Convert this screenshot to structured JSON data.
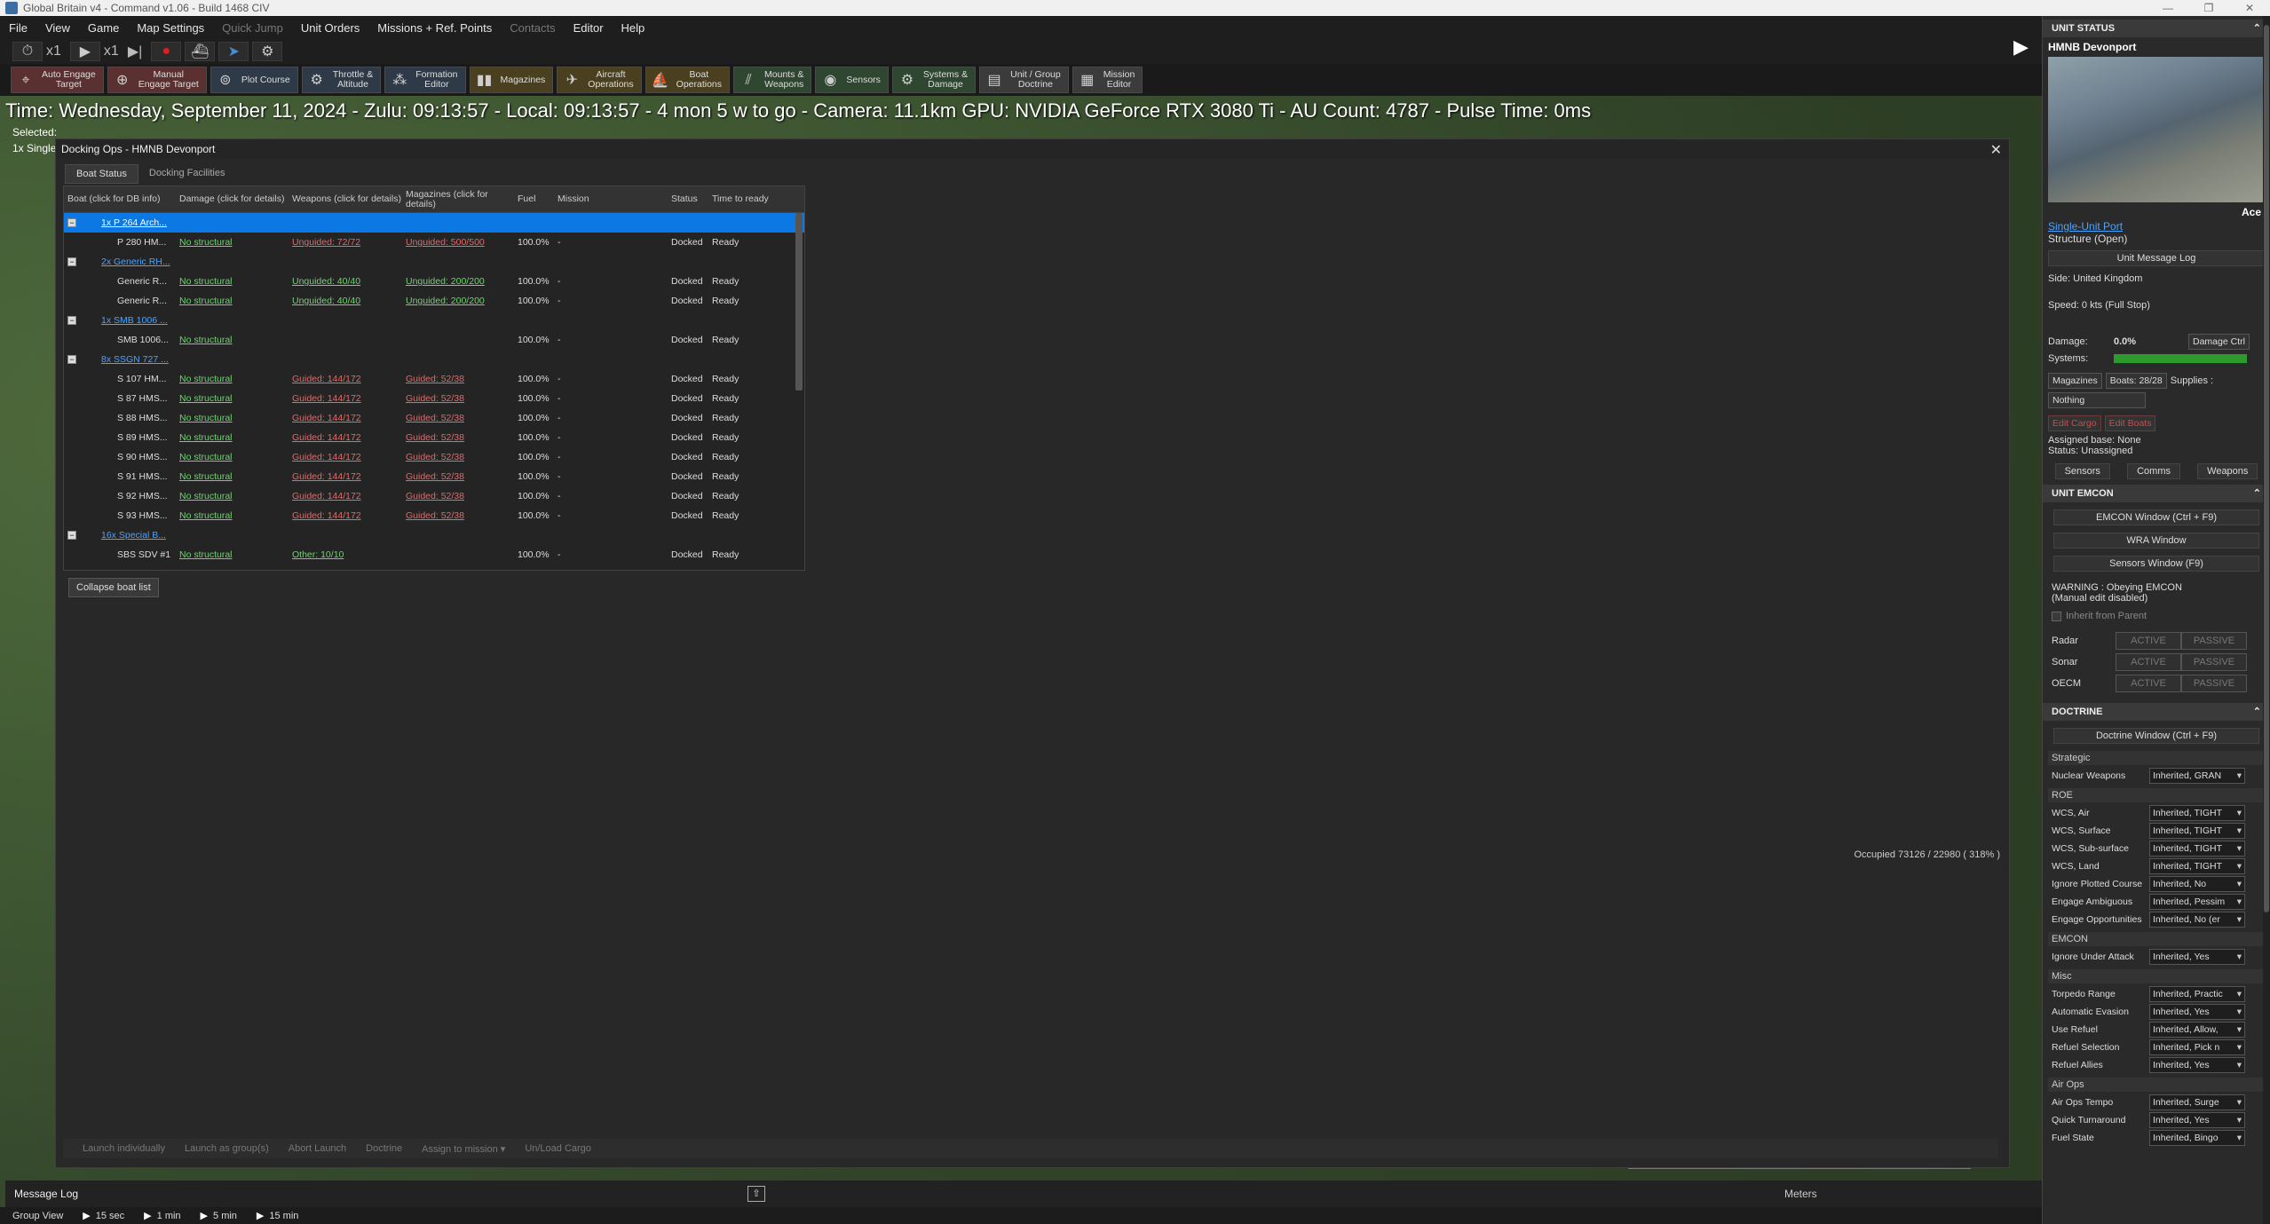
{
  "window": {
    "title": "Global Britain v4 - Command v1.06 - Build 1468 CIV",
    "controls": [
      "—",
      "❐",
      "✕"
    ]
  },
  "menu": [
    "File",
    "View",
    "Game",
    "Map Settings",
    "Quick Jump",
    "Unit Orders",
    "Missions + Ref. Points",
    "Contacts",
    "Editor",
    "Help"
  ],
  "time_controls": {
    "speed1": "x1",
    "speed2": "x1"
  },
  "toolbar": [
    {
      "line1": "Auto Engage",
      "line2": "Target",
      "icon": "crosshair-icon"
    },
    {
      "line1": "Manual",
      "line2": "Engage Target",
      "icon": "target-icon"
    },
    {
      "line1": "Plot Course",
      "line2": "",
      "icon": "course-icon"
    },
    {
      "line1": "Throttle &",
      "line2": "Altitude",
      "icon": "throttle-icon"
    },
    {
      "line1": "Formation",
      "line2": "Editor",
      "icon": "formation-icon"
    },
    {
      "line1": "Magazines",
      "line2": "",
      "icon": "magazine-icon"
    },
    {
      "line1": "Aircraft",
      "line2": "Operations",
      "icon": "aircraft-icon"
    },
    {
      "line1": "Boat",
      "line2": "Operations",
      "icon": "boat-icon"
    },
    {
      "line1": "Mounts &",
      "line2": "Weapons",
      "icon": "weapons-icon"
    },
    {
      "line1": "Sensors",
      "line2": "",
      "icon": "sensor-icon"
    },
    {
      "line1": "Systems &",
      "line2": "Damage",
      "icon": "systems-icon"
    },
    {
      "line1": "Unit / Group",
      "line2": "Doctrine",
      "icon": "doctrine-icon"
    },
    {
      "line1": "Mission",
      "line2": "Editor",
      "icon": "mission-icon"
    }
  ],
  "status_line": "Time: Wednesday, September 11, 2024 - Zulu: 09:13:57 - Local: 09:13:57 - 4 mon 5 w to go - Camera: 11.1km GPU: NVIDIA GeForce RTX 3080 Ti - AU Count: 4787 - Pulse Time: 0ms",
  "selected_label": "Selected:",
  "selected_sub": "1x Single",
  "dialog": {
    "title": "Docking Ops - HMNB Devonport",
    "close": "✕",
    "tabs": [
      "Boat Status",
      "Docking Facilities"
    ],
    "columns": [
      "Boat (click for DB info)",
      "Damage (click for details)",
      "Weapons (click for details)",
      "Magazines (click for details)",
      "Fuel",
      "Mission",
      "Status",
      "Time to ready"
    ],
    "rows": [
      {
        "kind": "group",
        "name": "1x P 264 Arch...",
        "selected": true
      },
      {
        "kind": "unit",
        "name": "P 280 HM...",
        "damage": "No structural",
        "weapons": "Unguided: 72/72",
        "wcolor": "red",
        "mags": "Unguided: 500/500",
        "mcolor": "red",
        "fuel": "100.0%",
        "mission": "-",
        "status": "Docked",
        "ready": "Ready"
      },
      {
        "kind": "group",
        "name": "2x Generic RH..."
      },
      {
        "kind": "unit",
        "name": "Generic R...",
        "damage": "No structural",
        "weapons": "Unguided: 40/40",
        "wcolor": "green",
        "mags": "Unguided: 200/200",
        "mcolor": "green",
        "fuel": "100.0%",
        "mission": "-",
        "status": "Docked",
        "ready": "Ready"
      },
      {
        "kind": "unit",
        "name": "Generic R...",
        "damage": "No structural",
        "weapons": "Unguided: 40/40",
        "wcolor": "green",
        "mags": "Unguided: 200/200",
        "mcolor": "green",
        "fuel": "100.0%",
        "mission": "-",
        "status": "Docked",
        "ready": "Ready"
      },
      {
        "kind": "group",
        "name": "1x SMB 1006 ..."
      },
      {
        "kind": "unit",
        "name": "SMB 1006...",
        "damage": "No structural",
        "weapons": "",
        "wcolor": "green",
        "mags": "",
        "mcolor": "green",
        "fuel": "100.0%",
        "mission": "-",
        "status": "Docked",
        "ready": "Ready"
      },
      {
        "kind": "group",
        "name": "8x SSGN 727 ..."
      },
      {
        "kind": "unit",
        "name": "S 107 HM...",
        "damage": "No structural",
        "weapons": "Guided: 144/172",
        "wcolor": "red",
        "mags": "Guided: 52/38",
        "mcolor": "red",
        "fuel": "100.0%",
        "mission": "-",
        "status": "Docked",
        "ready": "Ready"
      },
      {
        "kind": "unit",
        "name": "S 87 HMS...",
        "damage": "No structural",
        "weapons": "Guided: 144/172",
        "wcolor": "red",
        "mags": "Guided: 52/38",
        "mcolor": "red",
        "fuel": "100.0%",
        "mission": "-",
        "status": "Docked",
        "ready": "Ready"
      },
      {
        "kind": "unit",
        "name": "S 88 HMS...",
        "damage": "No structural",
        "weapons": "Guided: 144/172",
        "wcolor": "red",
        "mags": "Guided: 52/38",
        "mcolor": "red",
        "fuel": "100.0%",
        "mission": "-",
        "status": "Docked",
        "ready": "Ready"
      },
      {
        "kind": "unit",
        "name": "S 89 HMS...",
        "damage": "No structural",
        "weapons": "Guided: 144/172",
        "wcolor": "red",
        "mags": "Guided: 52/38",
        "mcolor": "red",
        "fuel": "100.0%",
        "mission": "-",
        "status": "Docked",
        "ready": "Ready"
      },
      {
        "kind": "unit",
        "name": "S 90 HMS...",
        "damage": "No structural",
        "weapons": "Guided: 144/172",
        "wcolor": "red",
        "mags": "Guided: 52/38",
        "mcolor": "red",
        "fuel": "100.0%",
        "mission": "-",
        "status": "Docked",
        "ready": "Ready"
      },
      {
        "kind": "unit",
        "name": "S 91 HMS...",
        "damage": "No structural",
        "weapons": "Guided: 144/172",
        "wcolor": "red",
        "mags": "Guided: 52/38",
        "mcolor": "red",
        "fuel": "100.0%",
        "mission": "-",
        "status": "Docked",
        "ready": "Ready"
      },
      {
        "kind": "unit",
        "name": "S 92 HMS...",
        "damage": "No structural",
        "weapons": "Guided: 144/172",
        "wcolor": "red",
        "mags": "Guided: 52/38",
        "mcolor": "red",
        "fuel": "100.0%",
        "mission": "-",
        "status": "Docked",
        "ready": "Ready"
      },
      {
        "kind": "unit",
        "name": "S 93 HMS...",
        "damage": "No structural",
        "weapons": "Guided: 144/172",
        "wcolor": "red",
        "mags": "Guided: 52/38",
        "mcolor": "red",
        "fuel": "100.0%",
        "mission": "-",
        "status": "Docked",
        "ready": "Ready"
      },
      {
        "kind": "group",
        "name": "16x Special B..."
      },
      {
        "kind": "unit",
        "name": "SBS SDV #1",
        "damage": "No structural",
        "weapons": "Other: 10/10",
        "wcolor": "green",
        "mags": "",
        "mcolor": "green",
        "fuel": "100.0%",
        "mission": "-",
        "status": "Docked",
        "ready": "Ready"
      }
    ],
    "collapse_button": "Collapse boat list",
    "occupied": "Occupied 73126 / 22980 ( 318% )",
    "bottom_actions": [
      "Launch individually",
      "Launch as group(s)",
      "Abort Launch",
      "Doctrine",
      "Assign to mission ▾",
      "Un/Load Cargo"
    ]
  },
  "message_log": "Message Log",
  "scale_label": "Meters",
  "group_view": {
    "label": "Group View",
    "steps": [
      "15 sec",
      "1 min",
      "5 min",
      "15 min"
    ]
  },
  "panel": {
    "unit_status_title": "UNIT STATUS",
    "unit_name": "HMNB Devonport",
    "photo_caption": "Ace",
    "unit_type_link": "Single-Unit Port",
    "unit_subtype": "Structure (Open)",
    "message_log_btn": "Unit Message Log",
    "side": "Side: United Kingdom",
    "speed": "Speed: 0 kts (Full Stop)",
    "damage_label": "Damage:",
    "damage_value": "0.0%",
    "damage_ctrl": "Damage Ctrl",
    "systems_label": "Systems:",
    "systems_level": 1.0,
    "magazines_btn": "Magazines",
    "boats_btn": "Boats: 28/28",
    "supplies_label": "Supplies :",
    "supplies_select": "Nothing",
    "edit_cargo": "Edit Cargo",
    "edit_boats": "Edit Boats",
    "assigned_base": "Assigned base: None",
    "status": "Status: Unassigned",
    "tabs": [
      "Sensors",
      "Comms",
      "Weapons"
    ],
    "emcon_title": "UNIT EMCON",
    "emcon_buttons": [
      "EMCON Window (Ctrl + F9)",
      "WRA Window",
      "Sensors Window (F9)"
    ],
    "warning_line1": "WARNING : Obeying EMCON",
    "warning_line2": "(Manual edit disabled)",
    "inherit": "Inherit from Parent",
    "emcon_rows": [
      {
        "label": "Radar",
        "active": "ACTIVE",
        "passive": "PASSIVE"
      },
      {
        "label": "Sonar",
        "active": "ACTIVE",
        "passive": "PASSIVE"
      },
      {
        "label": "OECM",
        "active": "ACTIVE",
        "passive": "PASSIVE"
      }
    ],
    "doctrine_title": "DOCTRINE",
    "doctrine_btn": "Doctrine Window (Ctrl + F9)",
    "doctrine_sections": [
      {
        "name": "Strategic",
        "rows": [
          {
            "label": "Nuclear Weapons",
            "value": "Inherited, GRAN"
          }
        ]
      },
      {
        "name": "ROE",
        "rows": [
          {
            "label": "WCS, Air",
            "value": "Inherited, TIGHT"
          },
          {
            "label": "WCS, Surface",
            "value": "Inherited, TIGHT"
          },
          {
            "label": "WCS, Sub-surface",
            "value": "Inherited, TIGHT"
          },
          {
            "label": "WCS, Land",
            "value": "Inherited, TIGHT"
          },
          {
            "label": "Ignore Plotted Course",
            "value": "Inherited, No"
          },
          {
            "label": "Engage Ambiguous",
            "value": "Inherited, Pessim"
          },
          {
            "label": "Engage Opportunities",
            "value": "Inherited, No (er"
          }
        ]
      },
      {
        "name": "EMCON",
        "rows": [
          {
            "label": "Ignore Under Attack",
            "value": "Inherited, Yes"
          }
        ]
      },
      {
        "name": "Misc",
        "rows": [
          {
            "label": "Torpedo Range",
            "value": "Inherited, Practic"
          },
          {
            "label": "Automatic Evasion",
            "value": "Inherited, Yes"
          },
          {
            "label": "Use Refuel",
            "value": "Inherited, Allow,"
          },
          {
            "label": "Refuel Selection",
            "value": "Inherited, Pick n"
          },
          {
            "label": "Refuel Allies",
            "value": "Inherited, Yes"
          }
        ]
      },
      {
        "name": "Air Ops",
        "rows": [
          {
            "label": "Air Ops Tempo",
            "value": "Inherited, Surge"
          },
          {
            "label": "Quick Turnaround",
            "value": "Inherited, Yes"
          },
          {
            "label": "Fuel State",
            "value": "Inherited, Bingo"
          }
        ]
      }
    ]
  }
}
